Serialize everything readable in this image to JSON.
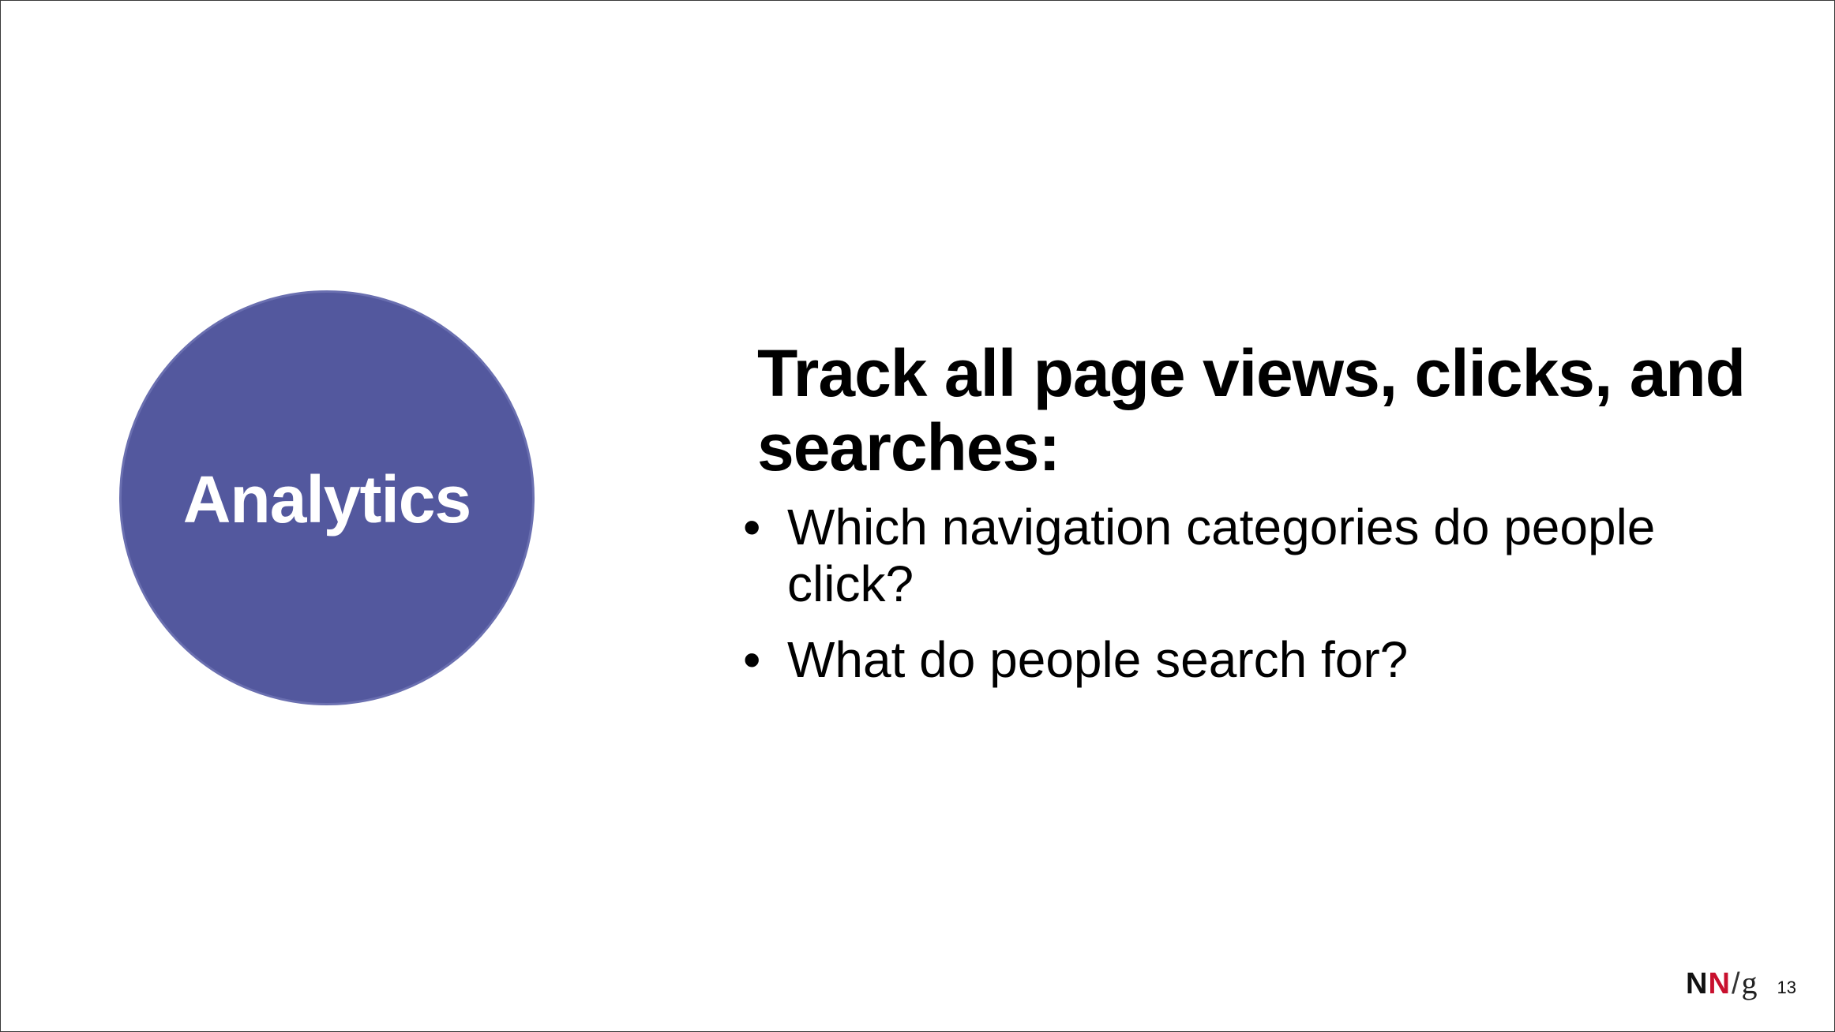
{
  "circle": {
    "label": "Analytics",
    "color": "#53589e"
  },
  "content": {
    "heading": "Track all page views, clicks, and searches:",
    "bullets": [
      "Which navigation categories do people click?",
      "What do people search for?"
    ]
  },
  "footer": {
    "logo": {
      "n1": "N",
      "n2": "N",
      "slash": "/",
      "g": "g",
      "accent_color": "#c8102e"
    },
    "page_number": "13"
  }
}
